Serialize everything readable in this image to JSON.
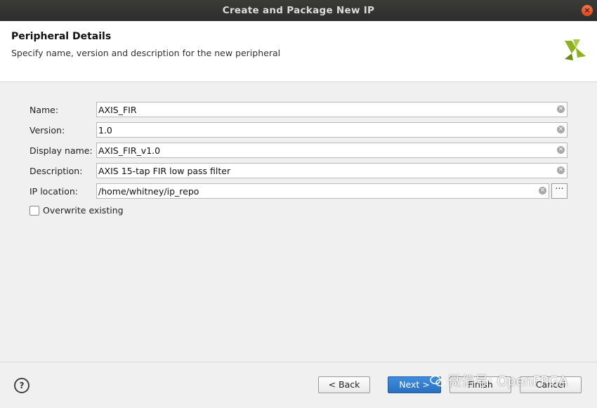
{
  "window": {
    "title": "Create and Package New IP",
    "close_glyph": "×"
  },
  "header": {
    "title": "Peripheral Details",
    "subtitle": "Specify name, version and description for the new peripheral",
    "logo_icon": "vivado-logo-icon"
  },
  "form": {
    "name": {
      "label": "Name:",
      "value": "AXIS_FIR"
    },
    "version": {
      "label": "Version:",
      "value": "1.0"
    },
    "display_name": {
      "label": "Display name:",
      "value": "AXIS_FIR_v1.0"
    },
    "description": {
      "label": "Description:",
      "value": "AXIS 15-tap FIR low pass filter"
    },
    "ip_location": {
      "label": "IP location:",
      "value": "/home/whitney/ip_repo",
      "browse_label": "···"
    },
    "overwrite": {
      "label": "Overwrite existing",
      "checked": false
    },
    "clear_glyph": "×"
  },
  "footer": {
    "help_label": "?",
    "back_label": "< Back",
    "next_label": "Next >",
    "finish_label": "Finish",
    "cancel_label": "Cancel"
  },
  "watermark": {
    "text": "微信号: OpenFPGA"
  },
  "colors": {
    "titlebar": "#2d2d2b",
    "primary_button": "#2a6fc0",
    "logo_green": "#8cb21e"
  }
}
